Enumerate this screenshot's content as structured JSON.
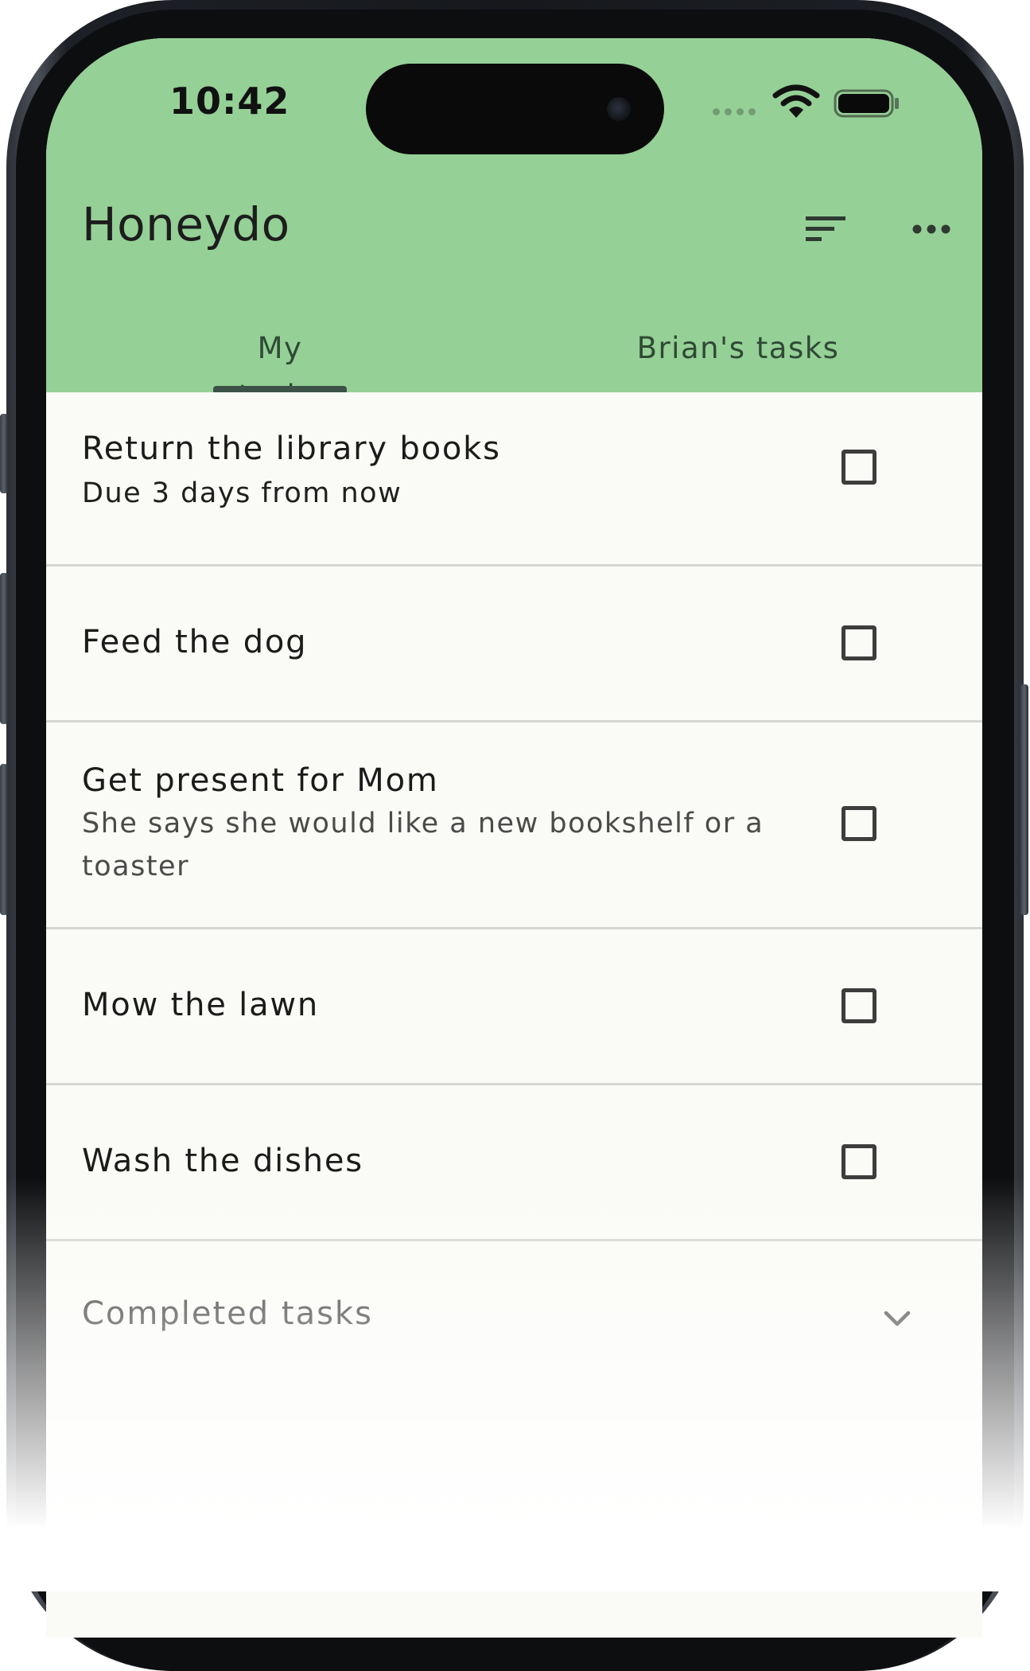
{
  "colors": {
    "brand": "#95d096",
    "list_background": "#fafaf6",
    "text_primary": "#1b1b1b",
    "text_secondary": "#484848",
    "divider": "#d6d6d2",
    "tab_indicator": "#3c5247"
  },
  "status_bar": {
    "time": "10:42",
    "icons": [
      "signal-dots-icon",
      "wifi-icon",
      "battery-icon"
    ]
  },
  "app_bar": {
    "title": "Honeydo",
    "actions": [
      {
        "icon": "sort-icon"
      },
      {
        "icon": "more-horizontal-icon"
      }
    ]
  },
  "tabs": [
    {
      "label": "My tasks",
      "selected": true
    },
    {
      "label": "Brian's tasks",
      "selected": false
    }
  ],
  "tasks": [
    {
      "title": "Return the library books",
      "subtitle": "Due 3 days from now",
      "checked": false
    },
    {
      "title": "Feed the dog",
      "subtitle": "",
      "checked": false
    },
    {
      "title": "Get present for Mom",
      "subtitle": "She says she would like a new bookshelf or a toaster",
      "checked": false
    },
    {
      "title": "Mow the lawn",
      "subtitle": "",
      "checked": false
    },
    {
      "title": "Wash the dishes",
      "subtitle": "",
      "checked": false
    }
  ],
  "completed_section": {
    "label": "Completed tasks",
    "icon": "chevron-down-icon",
    "expanded": false
  }
}
